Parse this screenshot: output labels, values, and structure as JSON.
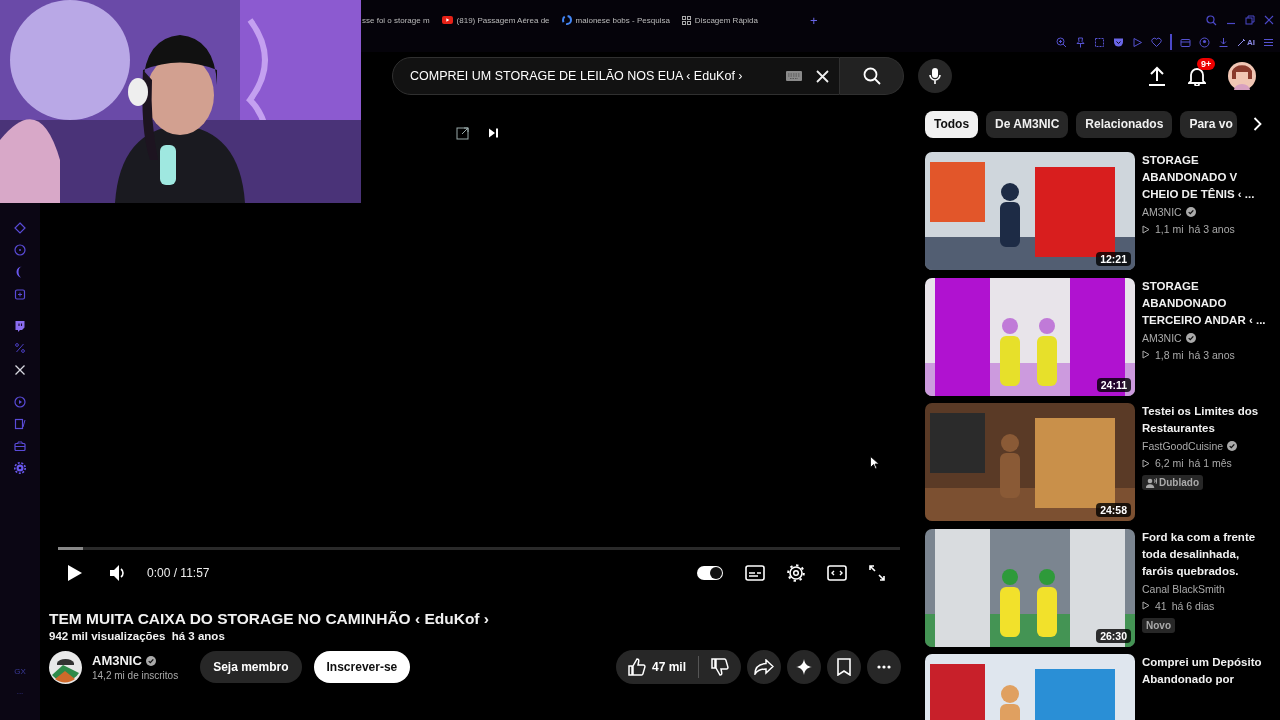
{
  "browser": {
    "tabs": [
      {
        "kind": "plain",
        "label": "sse foi o storage m"
      },
      {
        "kind": "youtube",
        "label": "(819) Passagem Aérea de"
      },
      {
        "kind": "google",
        "label": "maionese bobs - Pesquisa"
      },
      {
        "kind": "grid",
        "label": "Discagem Rápida"
      }
    ],
    "new_tab": "+",
    "toolbar_ai": "AI"
  },
  "masthead": {
    "search_value": "COMPREI UM STORAGE DE LEILÃO NOS EUA ‹ EduKof ›",
    "notifications": "9+"
  },
  "player": {
    "progress": {
      "level": 0.03
    },
    "time": "0:00 / 11:57",
    "autoplay": {
      "on": true
    }
  },
  "video": {
    "title": "TEM MUITA CAIXA DO STORAGE NO CAMINHÃO ‹ EduKof ›",
    "meta": "942 mil visualizações  há 3 anos",
    "channel": {
      "name": "AM3NIC",
      "verified": true,
      "subscribers": "14,2 mi de inscritos"
    },
    "join": "Seja membro",
    "subscribe": "Inscrever-se",
    "likes": "47 mil"
  },
  "chips": [
    {
      "label": "Todos",
      "selected": true
    },
    {
      "label": "De AM3NIC",
      "selected": false
    },
    {
      "label": "Relacionados",
      "selected": false
    },
    {
      "label": "Para vo",
      "selected": false
    }
  ],
  "recommendations": [
    {
      "title": "STORAGE ABANDONADO V CHEIO DE TÊNIS ‹ ...",
      "channel": "AM3NIC",
      "verified": true,
      "views": "1,1 mi",
      "age": "há 3 anos",
      "duration": "12:21"
    },
    {
      "title": "STORAGE ABANDONADO TERCEIRO ANDAR ‹ ...",
      "channel": "AM3NIC",
      "verified": true,
      "views": "1,8 mi",
      "age": "há 3 anos",
      "duration": "24:11"
    },
    {
      "title": "Testei os Limites dos Restaurantes",
      "channel": "FastGoodCuisine",
      "verified": true,
      "views": "6,2 mi",
      "age": "há 1 mês",
      "duration": "24:58",
      "badge": {
        "kind": "dubbed",
        "label": "Dublado"
      }
    },
    {
      "title": "Ford ka com a frente toda desalinhada, faróis quebrados.",
      "channel": "Canal BlackSmith",
      "verified": false,
      "views": "41",
      "age": "há 6 dias",
      "duration": "26:30",
      "badge": {
        "kind": "new",
        "label": "Novo"
      }
    },
    {
      "title": "Comprei um Depósito Abandonado por"
    }
  ],
  "sidebar": {
    "footer": "GX",
    "more": "..."
  }
}
